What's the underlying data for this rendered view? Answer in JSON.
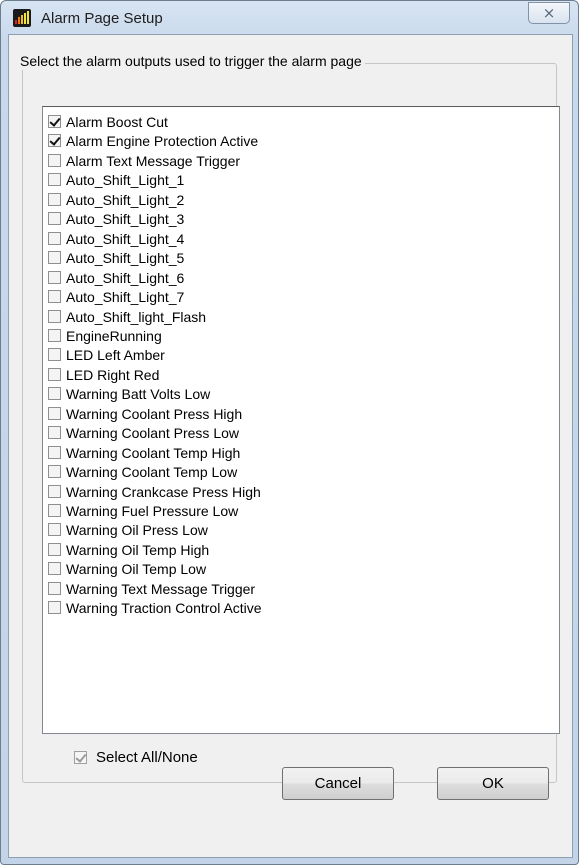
{
  "window": {
    "title": "Alarm Page Setup",
    "close_glyph": "⨯"
  },
  "group": {
    "legend": "Select the alarm outputs used to trigger the alarm page"
  },
  "items": [
    {
      "label": "Alarm Boost Cut",
      "checked": true
    },
    {
      "label": "Alarm Engine Protection Active",
      "checked": true
    },
    {
      "label": "Alarm Text Message Trigger",
      "checked": false
    },
    {
      "label": "Auto_Shift_Light_1",
      "checked": false
    },
    {
      "label": "Auto_Shift_Light_2",
      "checked": false
    },
    {
      "label": "Auto_Shift_Light_3",
      "checked": false
    },
    {
      "label": "Auto_Shift_Light_4",
      "checked": false
    },
    {
      "label": "Auto_Shift_Light_5",
      "checked": false
    },
    {
      "label": "Auto_Shift_Light_6",
      "checked": false
    },
    {
      "label": "Auto_Shift_Light_7",
      "checked": false
    },
    {
      "label": "Auto_Shift_light_Flash",
      "checked": false
    },
    {
      "label": "EngineRunning",
      "checked": false
    },
    {
      "label": "LED Left Amber",
      "checked": false
    },
    {
      "label": "LED Right Red",
      "checked": false
    },
    {
      "label": "Warning Batt Volts Low",
      "checked": false
    },
    {
      "label": "Warning Coolant Press High",
      "checked": false
    },
    {
      "label": "Warning Coolant Press Low",
      "checked": false
    },
    {
      "label": "Warning Coolant Temp High",
      "checked": false
    },
    {
      "label": "Warning Coolant Temp Low",
      "checked": false
    },
    {
      "label": "Warning Crankcase Press High",
      "checked": false
    },
    {
      "label": "Warning Fuel Pressure Low",
      "checked": false
    },
    {
      "label": "Warning Oil Press Low",
      "checked": false
    },
    {
      "label": "Warning Oil Temp High",
      "checked": false
    },
    {
      "label": "Warning Oil Temp Low",
      "checked": false
    },
    {
      "label": "Warning Text Message Trigger",
      "checked": false
    },
    {
      "label": "Warning Traction Control Active",
      "checked": false
    }
  ],
  "select_all": {
    "label": "Select All/None",
    "checked": true,
    "enabled": false
  },
  "buttons": {
    "cancel": "Cancel",
    "ok": "OK"
  },
  "app_icon": {
    "name": "bar-meter-icon",
    "colors": [
      "#e02020",
      "#f07a10",
      "#f2c21a",
      "#f2e640"
    ]
  }
}
